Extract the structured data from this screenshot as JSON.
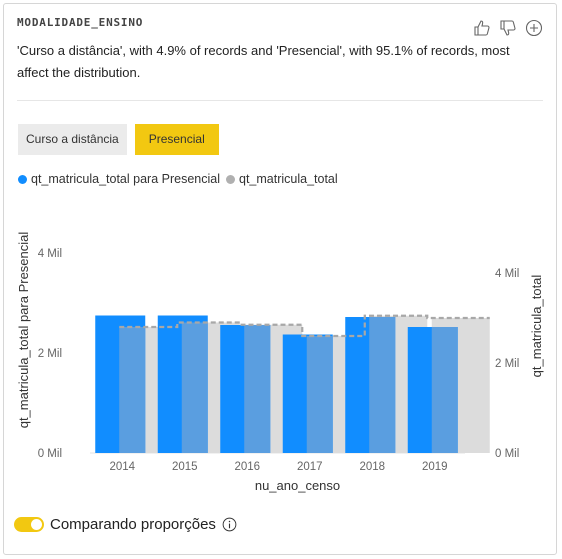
{
  "visual": {
    "field_name": "MODALIDADE_ENSINO",
    "summary": "'Curso a distância', with 4.9% of records and 'Presencial', with 95.1% of records, most affect the distribution.",
    "header_icons": [
      "thumbs-up-icon",
      "thumbs-down-icon",
      "add-circle-icon"
    ]
  },
  "segments": {
    "items": [
      {
        "label": "Curso a distância",
        "selected": false
      },
      {
        "label": "Presencial",
        "selected": true
      }
    ]
  },
  "legend": {
    "series1": "qt_matricula_total para Presencial",
    "series2": "qt_matricula_total"
  },
  "colors": {
    "series1": "#118dff",
    "series1_overlap": "#5a9ee0",
    "series2": "#dcdcdc",
    "series2_line": "#a8a8a8",
    "accent": "#f2c811"
  },
  "chart_data": {
    "type": "bar",
    "categories": [
      "2014",
      "2015",
      "2016",
      "2017",
      "2018",
      "2019"
    ],
    "series": [
      {
        "name": "qt_matricula_total para Presencial",
        "axis": "left",
        "values": [
          2750,
          2750,
          2560,
          2370,
          2720,
          2520
        ]
      },
      {
        "name": "qt_matricula_total",
        "axis": "right",
        "values": [
          2800,
          2900,
          2850,
          2600,
          3050,
          3000
        ]
      }
    ],
    "xlabel": "nu_ano_censo",
    "ylabel_left": "qt_matricula_total para Presencial",
    "ylabel_right": "qt_matricula_total",
    "ylim_left": [
      0,
      4000
    ],
    "ylim_right": [
      0,
      4000
    ],
    "yticks_left": [
      {
        "value": 0,
        "label": "0 Mil"
      },
      {
        "value": 2000,
        "label": "2 Mil"
      },
      {
        "value": 4000,
        "label": "4 Mil"
      }
    ],
    "yticks_right": [
      {
        "value": 0,
        "label": "0 Mil"
      },
      {
        "value": 2000,
        "label": "2 Mil"
      },
      {
        "value": 4000,
        "label": "4 Mil"
      }
    ],
    "legend_position": "top-left"
  },
  "footer": {
    "toggle_label": "Comparando proporções",
    "toggle_on": true,
    "info_icon": "info-icon"
  }
}
